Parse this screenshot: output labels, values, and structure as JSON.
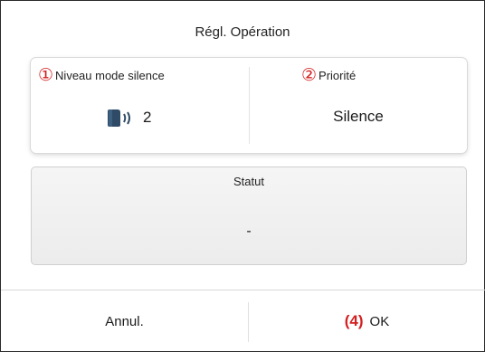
{
  "dialog": {
    "title": "Régl. Opération"
  },
  "settings": {
    "silent_level": {
      "marker": "①",
      "label": "Niveau mode silence",
      "icon": "fan-sound-icon",
      "value": "2"
    },
    "priority": {
      "marker": "②",
      "label": "Priorité",
      "value": "Silence"
    }
  },
  "status": {
    "label": "Statut",
    "value": "-"
  },
  "footer": {
    "cancel_label": "Annul.",
    "ok_marker": "(4)",
    "ok_label": "OK"
  },
  "colors": {
    "annotation_red": "#d42020",
    "frame_border": "#2a2a2a",
    "status_bg": "#f0f0f0"
  }
}
